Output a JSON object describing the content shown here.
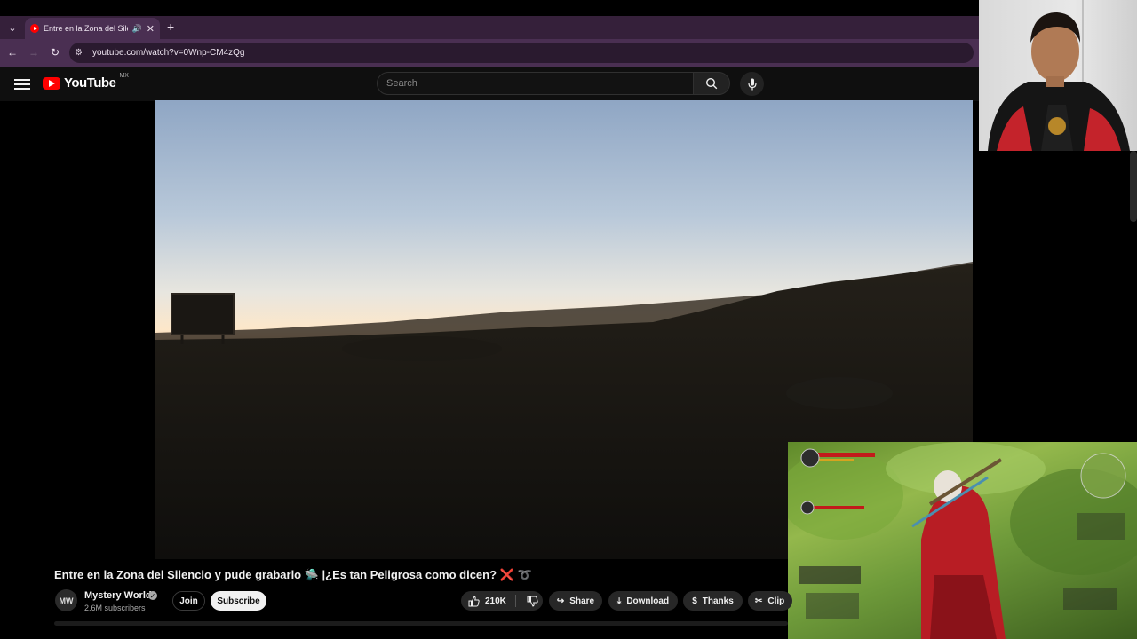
{
  "browser": {
    "tab_title": "Entre en la Zona del Silencio",
    "new_tab": "+",
    "url": "youtube.com/watch?v=0Wnp-CM4zQg"
  },
  "masthead": {
    "logo_text": "YouTube",
    "region": "MX",
    "search_placeholder": "Search"
  },
  "video": {
    "title": "Entre en la Zona del Silencio y pude grabarlo 🛸 |¿Es tan Peligrosa como dicen?",
    "title_x": "❌",
    "title_loop": "➰",
    "channel": {
      "avatar_text": "MW",
      "name": "Mystery World",
      "subscribers": "2.6M subscribers"
    },
    "actions": {
      "join": "Join",
      "subscribe": "Subscribe",
      "likes": "210K",
      "share": "Share",
      "download": "Download",
      "thanks": "Thanks",
      "clip": "Clip"
    }
  },
  "colors": {
    "browser_frame": "#4a2f52",
    "youtube_red": "#ff0000",
    "page_bg": "#0f0f0f"
  }
}
